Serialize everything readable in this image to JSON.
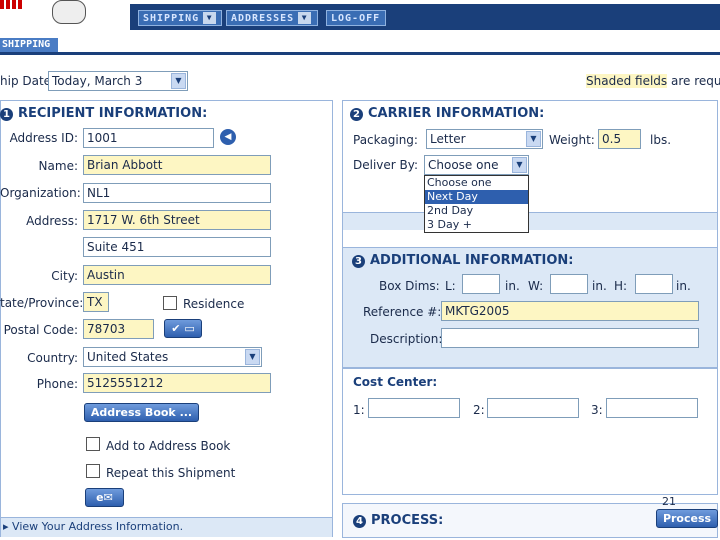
{
  "nav": {
    "shipping": "SHIPPING",
    "addresses": "ADDRESSES",
    "logoff": "LOG-OFF",
    "tab": "SHIPPING"
  },
  "shipdate": {
    "label": "hip Date",
    "value": "Today, March 3"
  },
  "shaded_note": {
    "emph": "Shaded fields",
    "rest": "are requir"
  },
  "recipient": {
    "number": "1",
    "title": "RECIPIENT INFORMATION:",
    "address_id_label": "Address ID:",
    "address_id": "1001",
    "name_label": "Name:",
    "name": "Brian Abbott",
    "org_label": "Organization:",
    "org": "NL1",
    "address_label": "Address:",
    "address1": "1717 W. 6th Street",
    "address2": "Suite 451",
    "city_label": "City:",
    "city": "Austin",
    "state_label": "tate/Province:",
    "state": "TX",
    "residence_label": "Residence",
    "postal_label": "Postal Code:",
    "postal": "78703",
    "country_label": "Country:",
    "country": "United States",
    "phone_label": "Phone:",
    "phone": "5125551212",
    "address_book_btn": "Address Book ...",
    "add_to_book": "Add to Address Book",
    "repeat": "Repeat this Shipment",
    "view_info": "View Your Address Information."
  },
  "carrier": {
    "number": "2",
    "title": "CARRIER INFORMATION:",
    "packaging_label": "Packaging:",
    "packaging": "Letter",
    "weight_label": "Weight:",
    "weight": "0.5",
    "lbs": "lbs.",
    "deliver_label": "Deliver By:",
    "deliver": "Choose one",
    "options": [
      "Choose one",
      "Next Day",
      "2nd Day",
      "3 Day +"
    ]
  },
  "additional": {
    "number": "3",
    "title": "ADDITIONAL INFORMATION:",
    "box_label": "Box Dims:",
    "l": "L:",
    "w": "W:",
    "h": "H:",
    "in": "in.",
    "ref_label": "Reference #:",
    "ref": "MKTG2005",
    "desc_label": "Description:"
  },
  "cost": {
    "title": "Cost Center:",
    "c1": "1:",
    "c2": "2:",
    "c3": "3:"
  },
  "process": {
    "number": "4",
    "title": "PROCESS:",
    "btn": "Process"
  },
  "page_number": "21",
  "colors": {
    "navy": "#1a3f7a",
    "shaded": "#fdf6c3",
    "panel_bg": "#dce8f6"
  }
}
